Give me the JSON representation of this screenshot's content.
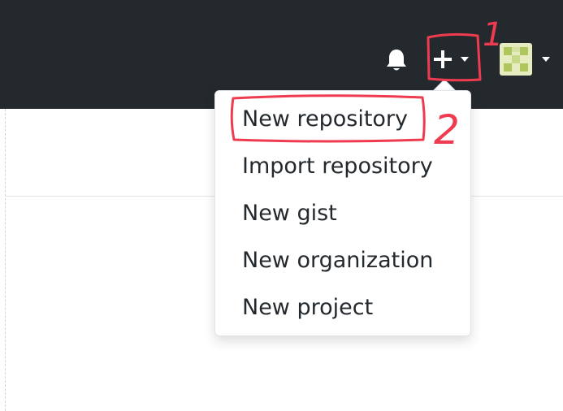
{
  "header": {
    "bell_icon": "bell-icon",
    "create_icon": "plus-icon",
    "caret_icon": "caret-down-icon",
    "avatar_icon": "avatar-identicon"
  },
  "dropdown": {
    "items": [
      {
        "label": "New repository"
      },
      {
        "label": "Import repository"
      },
      {
        "label": "New gist"
      },
      {
        "label": "New organization"
      },
      {
        "label": "New project"
      }
    ]
  },
  "annotations": {
    "step_1": "1",
    "step_2": "2",
    "color": "#ef3b4f"
  },
  "colors": {
    "header_bg": "#24292e",
    "menu_text": "#24292e",
    "icon_white": "#ffffff",
    "avatar_light": "#e6ecc0",
    "avatar_dark": "#aec65d"
  }
}
